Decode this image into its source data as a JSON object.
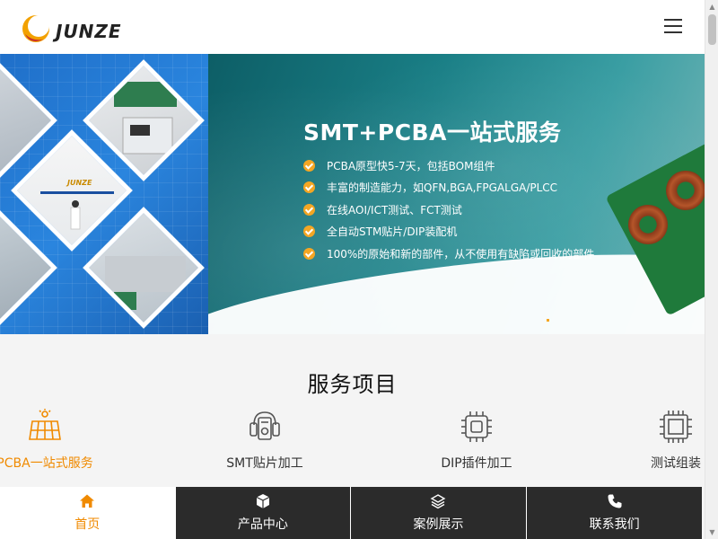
{
  "header": {
    "logo_text": "JUNZE",
    "menu_icon": "hamburger-menu-icon"
  },
  "banner": {
    "title": "SMT+PCBA一站式服务",
    "features": [
      "PCBA原型快5-7天，包括BOM组件",
      "丰富的制造能力，如QFN,BGA,FPGALGA/PLCC",
      "在线AOI/ICT测试、FCT测试",
      "全自动STM贴片/DIP装配机",
      "100%的原始和新的部件，从不使用有缺陷或回收的部件"
    ],
    "company_sign": "JUNZE"
  },
  "services": {
    "title": "服务项目",
    "items": [
      {
        "label": "PCBA一站式服务",
        "icon": "solar-grid-icon",
        "active": true
      },
      {
        "label": "SMT贴片加工",
        "icon": "circuit-device-icon",
        "active": false
      },
      {
        "label": "DIP插件加工",
        "icon": "chip-icon",
        "active": false
      },
      {
        "label": "测试组装",
        "icon": "processor-icon",
        "active": false
      }
    ]
  },
  "bottom_nav": [
    {
      "label": "首页",
      "icon": "home-icon",
      "active": true
    },
    {
      "label": "产品中心",
      "icon": "cube-icon",
      "active": false
    },
    {
      "label": "案例展示",
      "icon": "layers-icon",
      "active": false
    },
    {
      "label": "联系我们",
      "icon": "phone-icon",
      "active": false
    }
  ],
  "colors": {
    "accent": "#f08a00",
    "nav_dark": "#2b2b2b",
    "banner_blue": "#2a85de",
    "banner_teal": "#1a7f86"
  }
}
